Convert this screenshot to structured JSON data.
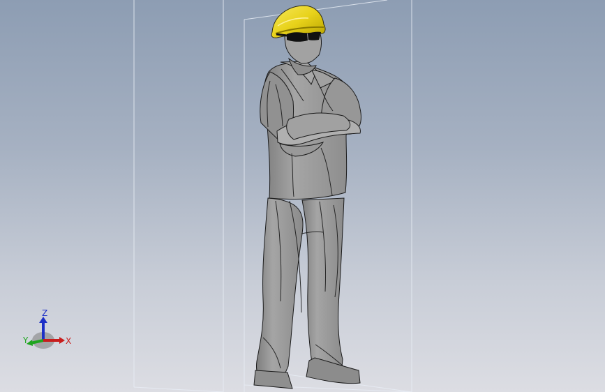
{
  "viewport": {
    "model": "hard-hat-worker",
    "colors": {
      "background_top": "#8d9db3",
      "background_bottom": "#dcdde3",
      "body": "#9a9a9a",
      "helmet": "#e8d21a",
      "glasses": "#111111",
      "bounding_box": "#e8edf5"
    }
  },
  "triad": {
    "z_label": "Z",
    "y_label": "Y",
    "x_label": "X",
    "colors": {
      "z": "#1c2fc7",
      "y": "#1fa51f",
      "x": "#c81d1d"
    }
  }
}
